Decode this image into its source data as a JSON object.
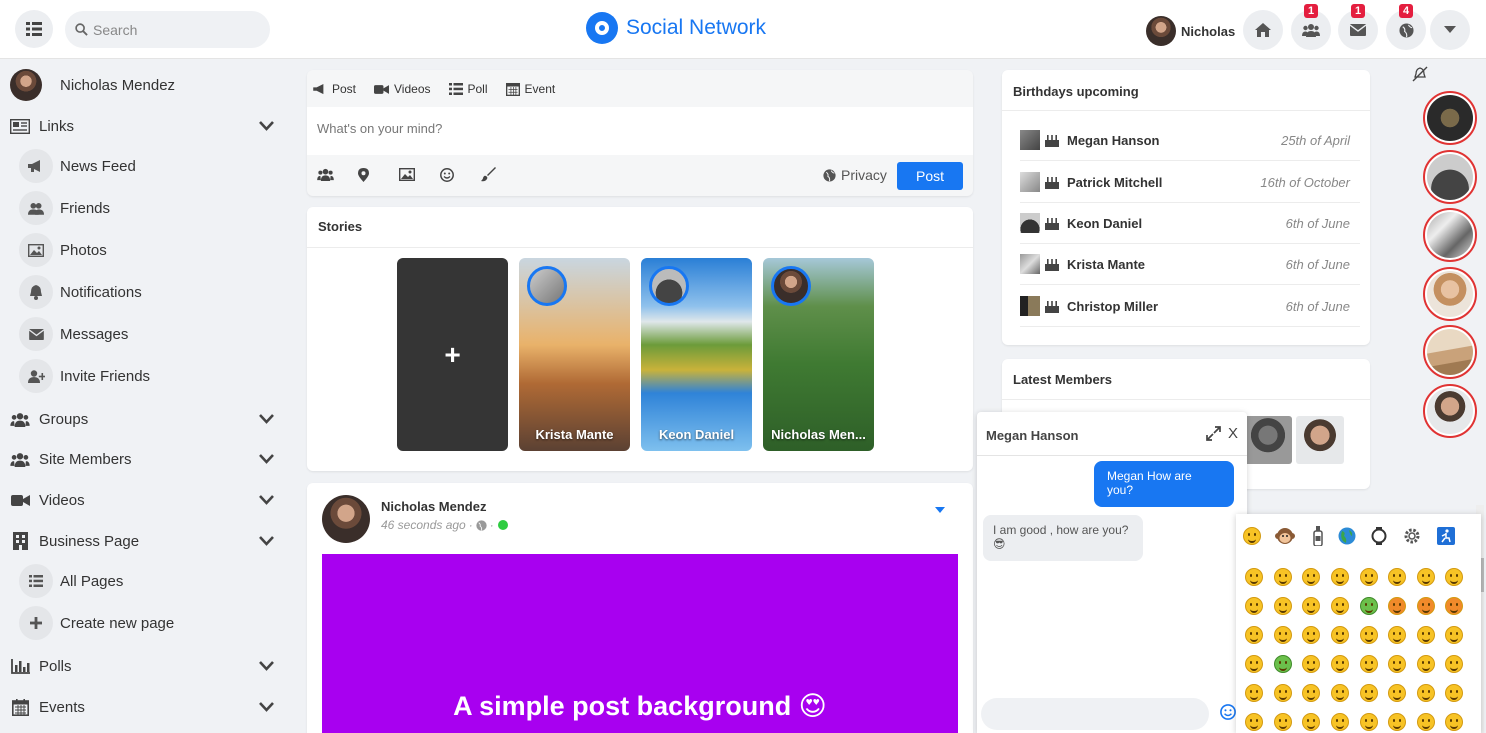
{
  "header": {
    "search_placeholder": "Search",
    "brand": "Social Network",
    "user_name": "Nicholas",
    "badges": {
      "friends": "1",
      "messages": "1",
      "notifications": "4"
    }
  },
  "sidebar": {
    "profile_name": "Nicholas Mendez",
    "items": [
      {
        "label": "Links"
      },
      {
        "label": "News Feed"
      },
      {
        "label": "Friends"
      },
      {
        "label": "Photos"
      },
      {
        "label": "Notifications"
      },
      {
        "label": "Messages"
      },
      {
        "label": "Invite Friends"
      },
      {
        "label": "Groups"
      },
      {
        "label": "Site Members"
      },
      {
        "label": "Videos"
      },
      {
        "label": "Business Page"
      },
      {
        "label": "All Pages"
      },
      {
        "label": "Create new page"
      },
      {
        "label": "Polls"
      },
      {
        "label": "Events"
      }
    ]
  },
  "composer": {
    "tabs": [
      "Post",
      "Videos",
      "Poll",
      "Event"
    ],
    "placeholder": "What's on your mind?",
    "privacy": "Privacy",
    "post_button": "Post"
  },
  "stories": {
    "title": "Stories",
    "add_symbol": "+",
    "items": [
      {
        "name": "Krista Mante"
      },
      {
        "name": "Keon Daniel"
      },
      {
        "name": "Nicholas Men..."
      }
    ]
  },
  "post": {
    "author": "Nicholas Mendez",
    "time": "46 seconds ago",
    "separator": "·",
    "text": "A simple post background 😍",
    "background_color": "#a800f0"
  },
  "birthdays": {
    "title": "Birthdays upcoming",
    "rows": [
      {
        "name": "Megan Hanson",
        "date": "25th of April"
      },
      {
        "name": "Patrick Mitchell",
        "date": "16th of October"
      },
      {
        "name": "Keon Daniel",
        "date": "6th of June"
      },
      {
        "name": "Krista Mante",
        "date": "6th of June"
      },
      {
        "name": "Christop Miller",
        "date": "6th of June"
      }
    ]
  },
  "members": {
    "title": "Latest Members"
  },
  "chat": {
    "name": "Megan Hanson",
    "close": "X",
    "messages": [
      {
        "direction": "out",
        "text": "Megan How are you?"
      },
      {
        "direction": "in",
        "text": "I am good , how are you? 😎"
      }
    ]
  },
  "colors": {
    "accent": "#1877f2",
    "online": "#2ecc40",
    "badge": "#e41e3f",
    "rail_ring": "#e03333"
  }
}
